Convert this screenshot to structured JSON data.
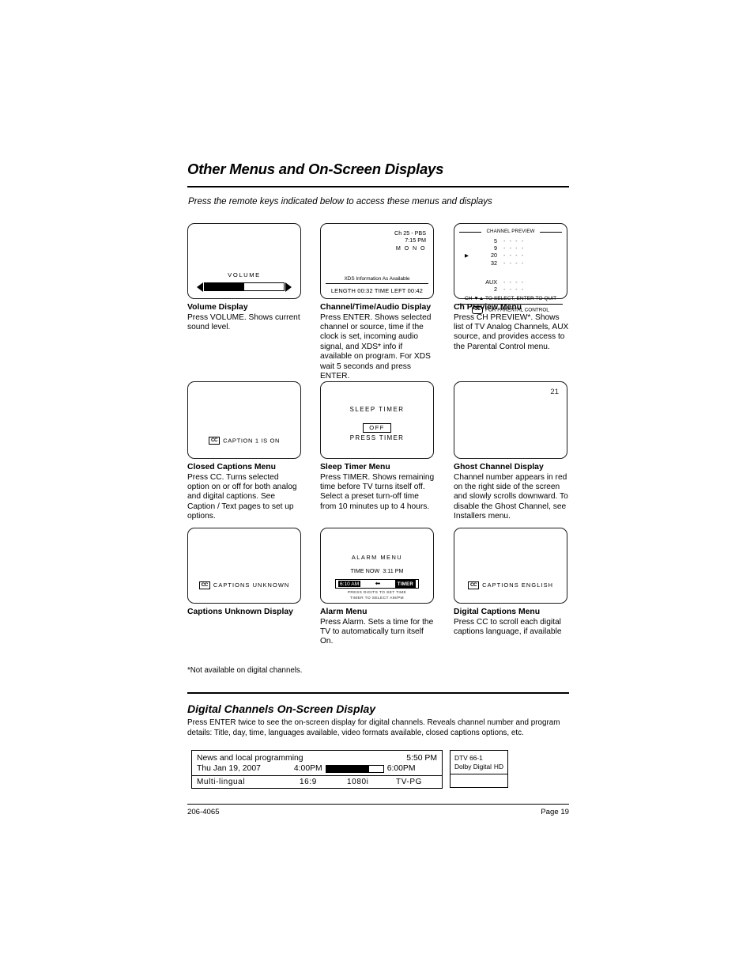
{
  "header": {
    "title": "Other Menus and On-Screen Displays",
    "subtitle": "Press the remote keys indicated below to access these menus and displays"
  },
  "panels": {
    "volume": {
      "label": "VOLUME",
      "fill_percent": 50,
      "left_arrow": "left-arrow-icon",
      "right_arrow": "right-arrow-icon",
      "caption_title": "Volume Display",
      "caption_body": "Press VOLUME. Shows current sound level."
    },
    "channel_time_audio": {
      "channel": "Ch 25 - PBS",
      "time": "7:15 PM",
      "audio": "M O N O",
      "xds": "XDS Information As Available",
      "bottom": "LENGTH 00:32   TIME LEFT 00:42",
      "caption_title": "Channel/Time/Audio Display",
      "caption_body": "Press ENTER. Shows selected channel or source, time if the clock is set, incoming audio signal, and XDS* info if available on program. For XDS wait 5 seconds and press ENTER."
    },
    "ch_preview": {
      "header": "CHANNEL PREVIEW",
      "rows": [
        {
          "pointer": "",
          "num": "5",
          "dashes": "- - - -"
        },
        {
          "pointer": "",
          "num": "9",
          "dashes": "- - - -"
        },
        {
          "pointer": "▶",
          "num": "20",
          "dashes": "- - - -"
        },
        {
          "pointer": "",
          "num": "32",
          "dashes": "- - - -"
        }
      ],
      "aux_rows": [
        {
          "pointer": "",
          "num": "AUX",
          "dashes": "- - - -"
        },
        {
          "pointer": "",
          "num": "2",
          "dashes": "- - - -"
        }
      ],
      "footer1": "CH ▼▲ TO SELECT, ENTER TO QUIT",
      "footer2_badge": "CC",
      "footer2": "FOR PARENTAL CONTROL",
      "caption_title": "Ch Preview Menu",
      "caption_body": "Press CH PREVIEW*. Shows list of TV Analog Channels, AUX source, and provides access to the Parental Control menu."
    },
    "closed_captions": {
      "badge": "CC",
      "text": "CAPTION 1 IS ON",
      "caption_title": "Closed Captions Menu",
      "caption_body": "Press CC. Turns selected option on or off for both analog and digital captions. See Caption / Text pages to set up options."
    },
    "sleep_timer": {
      "title": "SLEEP TIMER",
      "value": "OFF",
      "press": "PRESS TIMER",
      "caption_title": "Sleep Timer Menu",
      "caption_body": "Press TIMER. Shows remaining time before TV turns itself off. Select a preset turn-off time from 10 minutes up to 4 hours."
    },
    "ghost_channel": {
      "number": "21",
      "caption_title": "Ghost Channel Display",
      "caption_body": "Channel number appears in red on the right side of the screen and slowly scrolls downward. To disable the Ghost Channel, see Installers menu."
    },
    "captions_unknown": {
      "badge": "CC",
      "text": "CAPTIONS UNKNOWN",
      "caption_title": "Captions Unknown Display",
      "caption_body": ""
    },
    "alarm": {
      "title": "ALARM MENU",
      "time_now_label": "TIME NOW",
      "time_now": "3:11 PM",
      "alarm_time": "6:10 AM",
      "arrow": "left-arrow-icon",
      "timer_button": "TIMER",
      "hint1": "PRESS DIGITS TO SET TIME",
      "hint2": "TIMER TO SELECT AM/PM",
      "caption_title": "Alarm Menu",
      "caption_body": "Press Alarm. Sets a time for the TV to automatically turn itself On."
    },
    "digital_captions": {
      "badge": "CC",
      "text": "CAPTIONS ENGLISH",
      "caption_title": "Digital Captions Menu",
      "caption_body": "Press CC to scroll each digital captions language, if available"
    }
  },
  "footnote": "*Not available on digital channels.",
  "section2": {
    "title": "Digital Channels On-Screen Display",
    "body": "Press ENTER twice to see the on-screen display for digital channels. Reveals channel number and program details: Title, day, time, languages available, video formats available, closed captions options, etc."
  },
  "digital_osd": {
    "program_title": "News and local programming",
    "current_time": "5:50 PM",
    "date": "Thu Jan 19, 2007",
    "start_time": "4:00PM",
    "end_time": "6:00PM",
    "progress_percent": 76,
    "language": "Multi-lingual",
    "aspect": "16:9",
    "resolution": "1080i",
    "rating": "TV-PG",
    "channel": "DTV 66-1",
    "audio_format": "Dolby Digital",
    "hd_badge": "HD"
  },
  "footer": {
    "doc_number": "206-4065",
    "page": "Page  19"
  }
}
